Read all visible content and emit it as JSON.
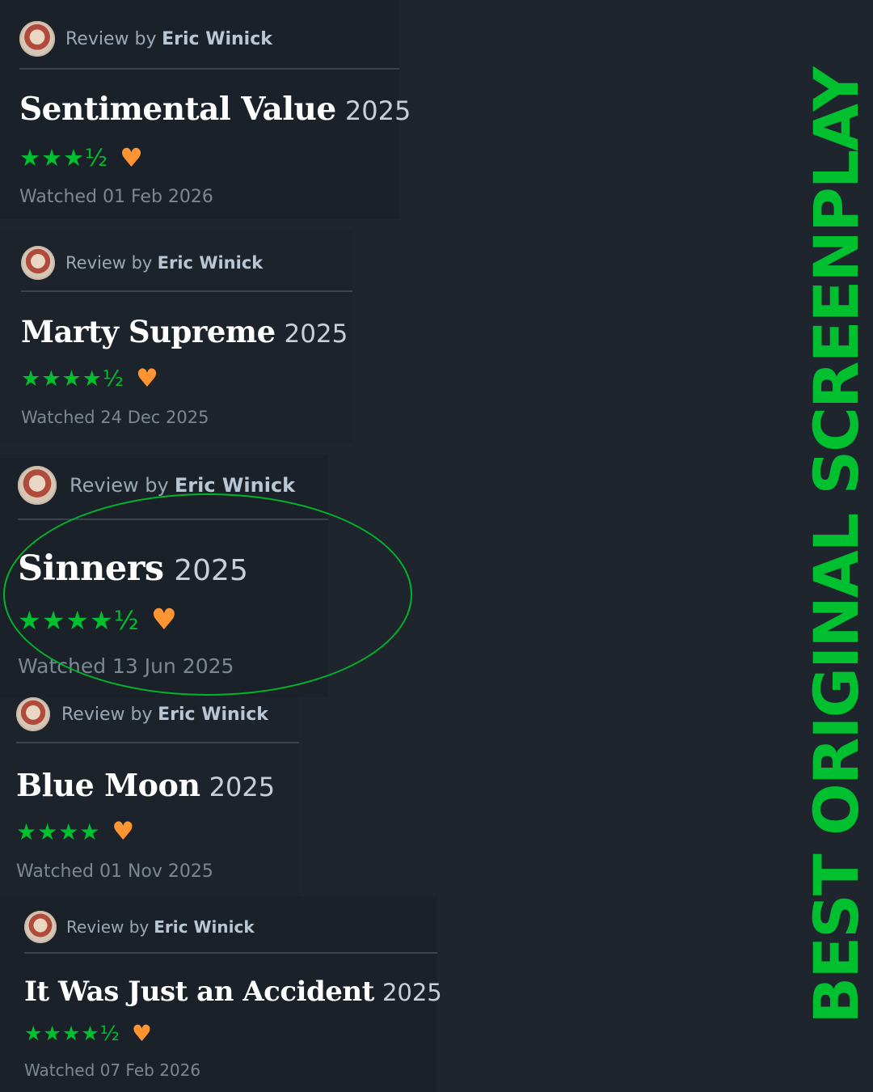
{
  "banner": {
    "text": "BEST ORIGINAL SCREENPLAY",
    "color": "#00c030"
  },
  "reviews": [
    {
      "review_prefix": "Review by",
      "reviewer": "Eric Winick",
      "title": "Sentimental Value",
      "year": "2025",
      "stars": "★★★½",
      "rating": 3.5,
      "liked": true,
      "heart": "♥",
      "watched": "Watched 01 Feb 2026"
    },
    {
      "review_prefix": "Review by",
      "reviewer": "Eric Winick",
      "title": "Marty Supreme",
      "year": "2025",
      "stars": "★★★★½",
      "rating": 4.5,
      "liked": true,
      "heart": "♥",
      "watched": "Watched 24 Dec 2025"
    },
    {
      "review_prefix": "Review by",
      "reviewer": "Eric Winick",
      "title": "Sinners",
      "year": "2025",
      "stars": "★★★★½",
      "rating": 4.5,
      "liked": true,
      "heart": "♥",
      "watched": "Watched 13 Jun 2025",
      "highlighted": true
    },
    {
      "review_prefix": "Review by",
      "reviewer": "Eric Winick",
      "title": "Blue Moon",
      "year": "2025",
      "stars": "★★★★",
      "rating": 4,
      "liked": true,
      "heart": "♥",
      "watched": "Watched 01 Nov 2025"
    },
    {
      "review_prefix": "Review by",
      "reviewer": "Eric Winick",
      "title": "It Was Just an Accident",
      "year": "2025",
      "stars": "★★★★½",
      "rating": 4.5,
      "liked": true,
      "heart": "♥",
      "watched": "Watched 07 Feb 2026"
    }
  ],
  "colors": {
    "background": "#1f252d",
    "star_green": "#00c030",
    "heart_orange": "#ff9433",
    "highlight_circle": "#00b52b"
  },
  "icons": {
    "avatar": "avatar-icon",
    "star": "star-icon",
    "heart": "heart-icon"
  }
}
